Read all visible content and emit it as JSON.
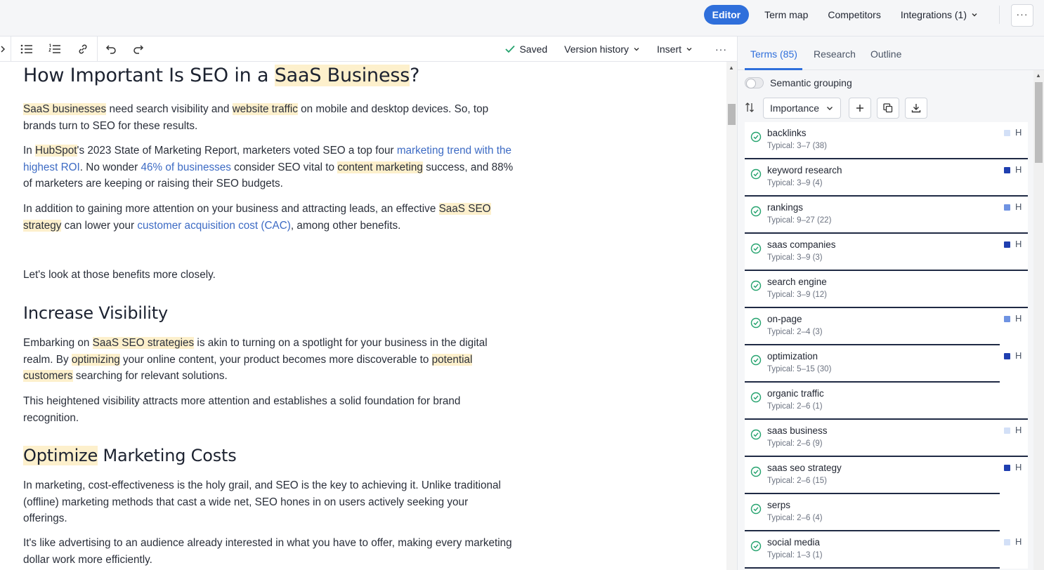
{
  "topbar": {
    "editor_label": "Editor",
    "term_map_label": "Term map",
    "competitors_label": "Competitors",
    "integrations_label": "Integrations (1)",
    "more_label": "···"
  },
  "toolbar": {
    "saved_label": "Saved",
    "version_history_label": "Version history",
    "insert_label": "Insert",
    "more_label": "···"
  },
  "doc": {
    "h1_a": "How Important Is SEO in a ",
    "h1_hl": "SaaS Business",
    "h1_b": "?",
    "p1": {
      "hl1": "SaaS businesses",
      "t1": " need search visibility and ",
      "hl2": "website traffic",
      "t2": " on mobile and desktop devices. So, top brands turn to SEO for these results."
    },
    "p2": {
      "t0": "In ",
      "hl1": "HubSpot",
      "t1": "'s 2023 State of Marketing Report, marketers voted SEO a top four ",
      "link1": "marketing trend with the highest ROI",
      "t2": ". No wonder ",
      "link2": "46% of businesses",
      "t3": " consider SEO vital to ",
      "hl2": "content marketing",
      "t4": " success, and 88% of marketers are keeping or raising their SEO budgets."
    },
    "p3": {
      "t1": "In addition to gaining more attention on your business and attracting leads, an effective ",
      "hl1": "SaaS SEO strategy",
      "t2": " can lower your ",
      "link1": "customer acquisition cost (CAC)",
      "t3": ", among other benefits."
    },
    "p4": "Let's look at those benefits more closely.",
    "h2a": "Increase Visibility",
    "p5": {
      "t1": "Embarking on ",
      "hl1": "SaaS SEO strategies",
      "t2": " is akin to turning on a spotlight for your business in the digital realm. By ",
      "hl2": "optimizing",
      "t3": " your online content, your product becomes more discoverable to ",
      "hl3": "potential customers",
      "t4": " searching for relevant solutions."
    },
    "p6": "This heightened visibility attracts more attention and establishes a solid foundation for brand recognition.",
    "h2b_hl": "Optimize",
    "h2b": " Marketing Costs",
    "p7": "In marketing, cost-effectiveness is the holy grail, and SEO is the key to achieving it. Unlike traditional (offline) marketing methods that cast a wide net, SEO hones in on users actively seeking your offerings.",
    "p8": "It's like advertising to an audience already interested in what you have to offer, making every marketing dollar work more efficiently."
  },
  "panel": {
    "tabs": [
      "Terms (85)",
      "Research",
      "Outline"
    ],
    "semantic_grouping_label": "Semantic grouping",
    "sort_select_value": "Importance",
    "terms": [
      {
        "name": "backlinks",
        "typical": "Typical: 3–7 (38)",
        "marker": "H",
        "marker_color": "#d3e0f7",
        "progress": 1.0
      },
      {
        "name": "keyword research",
        "typical": "Typical: 3–9 (4)",
        "marker": "H",
        "marker_color": "#1f3fb0",
        "progress": 1.0
      },
      {
        "name": "rankings",
        "typical": "Typical: 9–27 (22)",
        "marker": "H",
        "marker_color": "#6f93e2",
        "progress": 1.0
      },
      {
        "name": "saas companies",
        "typical": "Typical: 3–9 (3)",
        "marker": "H",
        "marker_color": "#1f3fb0",
        "progress": 1.0
      },
      {
        "name": "search engine",
        "typical": "Typical: 3–9 (12)",
        "marker": "",
        "marker_color": "",
        "progress": 1.0
      },
      {
        "name": "on-page",
        "typical": "Typical: 2–4 (3)",
        "marker": "H",
        "marker_color": "#6f93e2",
        "progress": 0.9
      },
      {
        "name": "optimization",
        "typical": "Typical: 5–15 (30)",
        "marker": "H",
        "marker_color": "#1f3fb0",
        "progress": 0.9
      },
      {
        "name": "organic traffic",
        "typical": "Typical: 2–6 (1)",
        "marker": "",
        "marker_color": "",
        "progress": 1.0
      },
      {
        "name": "saas business",
        "typical": "Typical: 2–6 (9)",
        "marker": "H",
        "marker_color": "#d3e0f7",
        "progress": 1.0
      },
      {
        "name": "saas seo strategy",
        "typical": "Typical: 2–6 (15)",
        "marker": "H",
        "marker_color": "#1f3fb0",
        "progress": 0.9
      },
      {
        "name": "serps",
        "typical": "Typical: 2–6 (4)",
        "marker": "",
        "marker_color": "",
        "progress": 0.9
      },
      {
        "name": "social media",
        "typical": "Typical: 1–3 (1)",
        "marker": "H",
        "marker_color": "#d3e0f7",
        "progress": 0.9
      }
    ]
  }
}
